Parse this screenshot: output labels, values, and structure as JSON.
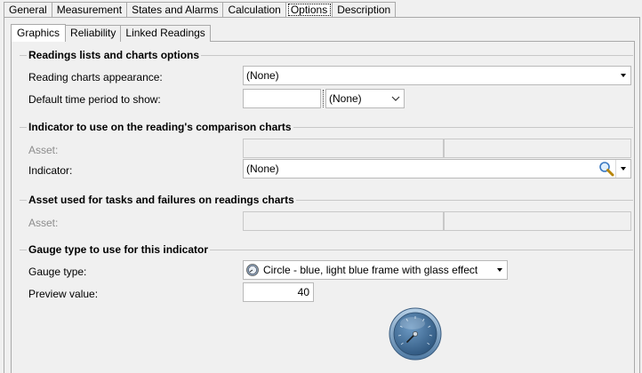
{
  "top_tabs": [
    "General",
    "Measurement",
    "States and Alarms",
    "Calculation",
    "Options",
    "Description"
  ],
  "active_top_tab": "Options",
  "inner_tabs": [
    "Graphics",
    "Reliability",
    "Linked Readings"
  ],
  "active_inner_tab": "Graphics",
  "readings_group": {
    "title": "Readings lists and charts options",
    "appearance_label": "Reading charts appearance:",
    "appearance_value": "(None)",
    "period_label": "Default time period to show:",
    "period_value": "",
    "period_unit_value": "(None)"
  },
  "indicator_group": {
    "title": "Indicator to use on the reading's comparison charts",
    "asset_label": "Asset:",
    "asset_value": "",
    "asset_value2": "",
    "indicator_label": "Indicator:",
    "indicator_value": "(None)"
  },
  "tasks_group": {
    "title": "Asset used for tasks and failures on readings charts",
    "asset_label": "Asset:",
    "asset_value": "",
    "asset_value2": ""
  },
  "gauge_group": {
    "title": "Gauge type to use for this indicator",
    "type_label": "Gauge type:",
    "type_value": "Circle - blue, light blue frame with glass effect",
    "preview_label": "Preview value:",
    "preview_value": "40"
  },
  "icons": {
    "search": "magnifier-icon",
    "gauge": "circle-gauge-icon"
  },
  "colors": {
    "background": "#f0f0f0",
    "gauge_face": "#3e6f9c",
    "gauge_frame": "#7fa6c8"
  }
}
